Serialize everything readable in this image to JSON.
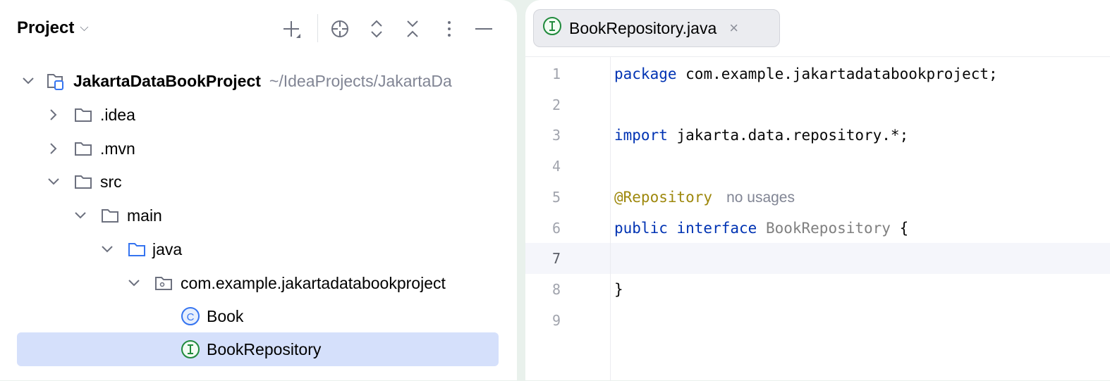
{
  "project_panel": {
    "title": "Project",
    "toolbar": [
      "add",
      "locate",
      "expand-all",
      "collapse-all",
      "options",
      "hide"
    ]
  },
  "tree": [
    {
      "label": "JakartaDataBookProject",
      "path": "~/IdeaProjects/JakartaDa"
    },
    {
      "label": ".idea"
    },
    {
      "label": ".mvn"
    },
    {
      "label": "src"
    },
    {
      "label": "main"
    },
    {
      "label": "java"
    },
    {
      "label": "com.example.jakartadatabookproject"
    },
    {
      "label": "Book"
    },
    {
      "label": "BookRepository"
    }
  ],
  "editor": {
    "tab": {
      "label": "BookRepository.java",
      "close": "×"
    },
    "line_numbers": [
      "1",
      "2",
      "3",
      "4",
      "5",
      "6",
      "7",
      "8",
      "9"
    ],
    "code": {
      "l1_kw": "package",
      "l1_rest": " com.example.jakartadatabookproject;",
      "l3_kw": "import",
      "l3_rest": " jakarta.data.repository.*;",
      "l5_ann": "@Repository",
      "l5_hint": "no usages",
      "l6_kw": "public interface",
      "l6_name": " BookRepository",
      "l6_rest": " {",
      "l8": "}"
    }
  },
  "colors": {
    "keyword": "#0033b3",
    "annotation": "#9e880d",
    "selection": "#d5e0fb",
    "interface_icon": "#208a3c",
    "class_icon": "#3574f0"
  }
}
